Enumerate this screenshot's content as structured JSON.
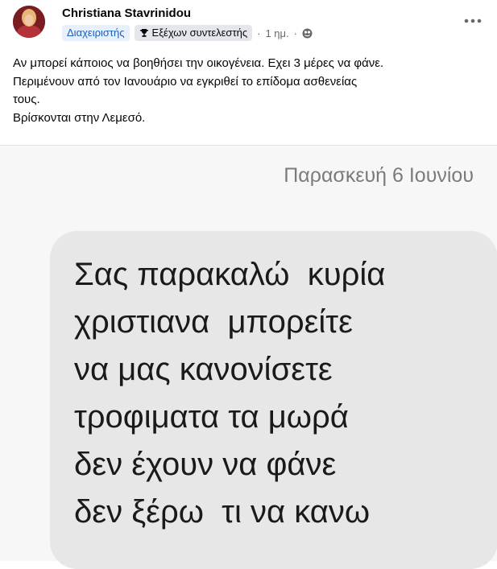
{
  "post": {
    "author": "Christiana Stavrinidou",
    "role_badge": "Διαχειριστής",
    "contributor_badge": "Εξέχων συντελεστής",
    "separator": "·",
    "time": "1 ημ.",
    "lines": [
      "Αν μπορεί κάποιος να βοηθήσει την οικογένεια. Εχει 3 μέρες να φάνε.",
      "Περιμένουν από τον Ιανουάριο να εγκριθεί το επίδομα ασθενείας",
      "τους.",
      "Βρίσκονται στην Λεμεσό."
    ]
  },
  "screenshot": {
    "date": "Παρασκευή 6 Ιουνίου",
    "message_lines": [
      "Σας παρακαλώ  κυρία",
      "χριστιανα  μπορείτε",
      "να μας κανονίσετε",
      "τροφιματα τα μωρά",
      "δεν έχουν να φάνε",
      "δεν ξέρω  τι να κανω"
    ]
  },
  "icons": {
    "avatar": "avatar",
    "trophy": "trophy-icon",
    "globe": "globe-icon",
    "more": "more-options-icon"
  },
  "colors": {
    "name": "#050505",
    "badge_blue_text": "#1b5fb6",
    "badge_blue_bg": "#e7f0fb",
    "meta_gray": "#65676b",
    "bubble_bg": "#e7e7e7"
  }
}
